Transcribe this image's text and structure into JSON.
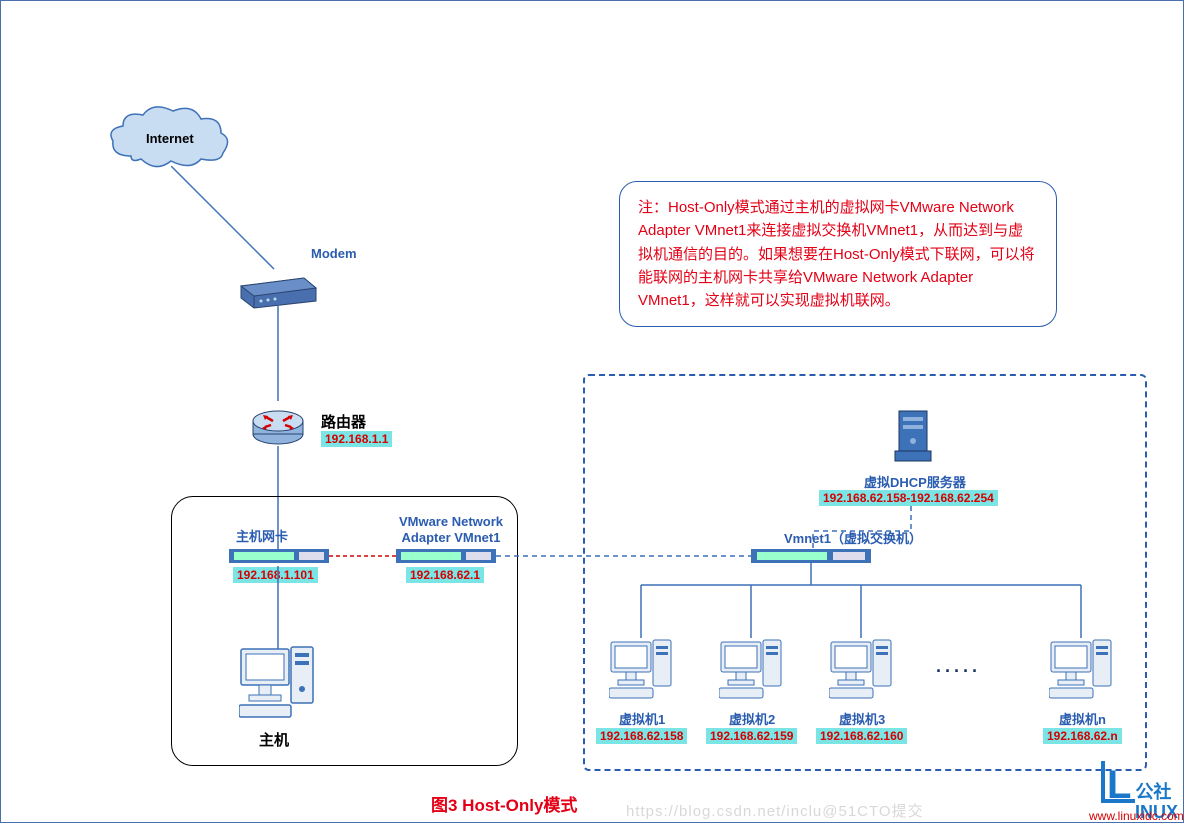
{
  "cloud_label": "Internet",
  "modem_label": "Modem",
  "router": {
    "label": "路由器",
    "ip": "192.168.1.1"
  },
  "host_nic": {
    "label": "主机网卡",
    "ip": "192.168.1.101"
  },
  "vmnet1_adapter": {
    "label1": "VMware Network",
    "label2": "Adapter VMnet1",
    "ip": "192.168.62.1"
  },
  "host_label": "主机",
  "switch_label": "Vmnet1（虚拟交换机）",
  "dhcp": {
    "label": "虚拟DHCP服务器",
    "range": "192.168.62.158-192.168.62.254"
  },
  "vms": [
    {
      "name": "虚拟机1",
      "ip": "192.168.62.158"
    },
    {
      "name": "虚拟机2",
      "ip": "192.168.62.159"
    },
    {
      "name": "虚拟机3",
      "ip": "192.168.62.160"
    },
    {
      "name": "虚拟机n",
      "ip": "192.168.62.n"
    }
  ],
  "ellipsis": "·····",
  "note_text": "注：Host-Only模式通过主机的虚拟网卡VMware Network Adapter VMnet1来连接虚拟交换机VMnet1，从而达到与虚拟机通信的目的。如果想要在Host-Only模式下联网，可以将能联网的主机网卡共享给VMware Network Adapter VMnet1，这样就可以实现虚拟机联网。",
  "caption": "图3  Host-Only模式",
  "watermark": "https://blog.csdn.net/inclu@51CTO提交",
  "url_mark": "www.linuxidc.com",
  "logo1": "公社",
  "logo2": "INUX"
}
